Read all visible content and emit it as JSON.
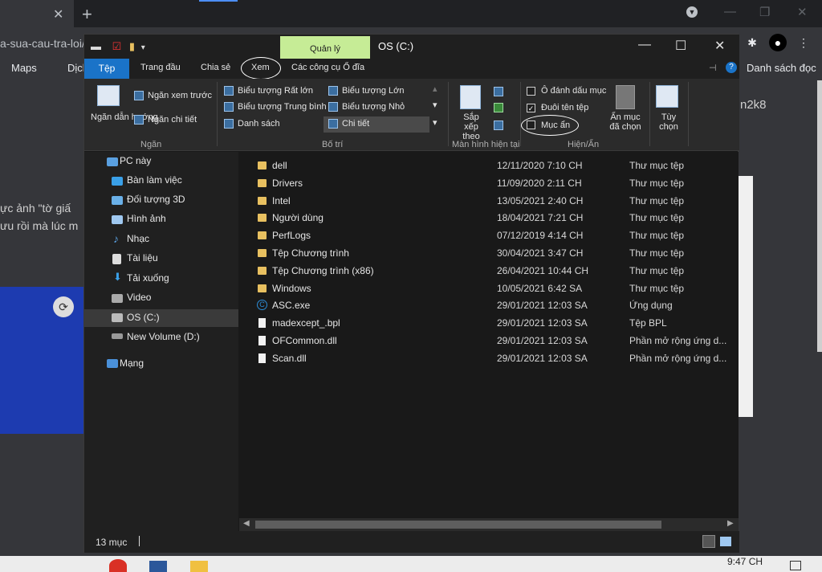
{
  "browser": {
    "url_fragment": "a-sua-cau-tra-loi/",
    "bookmarks": [
      {
        "label": "Maps"
      },
      {
        "label": "Dịch"
      },
      {
        "label": "Danh sách đọc"
      }
    ],
    "page_texts": [
      "ực ảnh \"tờ giấ",
      "ưu rồi mà lúc m",
      "n2k8"
    ]
  },
  "explorer": {
    "title": "OS (C:)",
    "manage_tab": "Quản lý",
    "ribbon_tabs": [
      "Tệp",
      "Trang đầu",
      "Chia sẻ",
      "Xem",
      "Các công cụ Ổ đĩa"
    ],
    "panes": {
      "nav_pane": "Ngăn dẫn hướng",
      "preview_pane": "Ngăn xem trước",
      "details_pane": "Ngăn chi tiết",
      "group": "Ngăn"
    },
    "layout": {
      "items": [
        "Biểu tượng Rất lớn",
        "Biểu tượng Lớn",
        "Biểu tượng Trung bình",
        "Biểu tượng Nhỏ",
        "Danh sách",
        "Chi tiết"
      ],
      "group": "Bố trí"
    },
    "current_view": {
      "sort_by": "Sắp xếp theo",
      "group": "Màn hình hiện tại"
    },
    "show_hide": {
      "item_checkboxes": "Ô đánh dấu mục",
      "item_checkboxes_checked": false,
      "file_extensions": "Đuôi tên tệp",
      "file_extensions_checked": true,
      "hidden_items": "Mục ẩn",
      "hidden_items_checked": false,
      "hide_selected": "Ẩn mục đã chọn",
      "options": "Tùy chọn",
      "group": "Hiện/Ẩn"
    },
    "nav": [
      {
        "label": "PC này"
      },
      {
        "label": "Bàn làm việc"
      },
      {
        "label": "Đối tượng 3D"
      },
      {
        "label": "Hình ảnh"
      },
      {
        "label": "Nhạc"
      },
      {
        "label": "Tài liệu"
      },
      {
        "label": "Tải xuống"
      },
      {
        "label": "Video"
      },
      {
        "label": "OS (C:)"
      },
      {
        "label": "New Volume (D:)"
      },
      {
        "label": "Mạng"
      }
    ],
    "files": [
      {
        "name": "dell",
        "date": "12/11/2020 7:10 CH",
        "type": "Thư mục tệp",
        "kind": "folder"
      },
      {
        "name": "Drivers",
        "date": "11/09/2020 2:11 CH",
        "type": "Thư mục tệp",
        "kind": "folder"
      },
      {
        "name": "Intel",
        "date": "13/05/2021 2:40 CH",
        "type": "Thư mục tệp",
        "kind": "folder"
      },
      {
        "name": "Người dùng",
        "date": "18/04/2021 7:21 CH",
        "type": "Thư mục tệp",
        "kind": "folder"
      },
      {
        "name": "PerfLogs",
        "date": "07/12/2019 4:14 CH",
        "type": "Thư mục tệp",
        "kind": "folder"
      },
      {
        "name": "Tệp Chương trình",
        "date": "30/04/2021 3:47 CH",
        "type": "Thư mục tệp",
        "kind": "folder"
      },
      {
        "name": "Tệp Chương trình (x86)",
        "date": "26/04/2021 10:44 CH",
        "type": "Thư mục tệp",
        "kind": "folder"
      },
      {
        "name": "Windows",
        "date": "10/05/2021 6:42 SA",
        "type": "Thư mục tệp",
        "kind": "folder"
      },
      {
        "name": "ASC.exe",
        "date": "29/01/2021 12:03 SA",
        "type": "Ứng dụng",
        "kind": "exe"
      },
      {
        "name": "madexcept_.bpl",
        "date": "29/01/2021 12:03 SA",
        "type": "Tệp BPL",
        "kind": "file"
      },
      {
        "name": "OFCommon.dll",
        "date": "29/01/2021 12:03 SA",
        "type": "Phần mở rộng ứng d...",
        "kind": "dll"
      },
      {
        "name": "Scan.dll",
        "date": "29/01/2021 12:03 SA",
        "type": "Phần mở rộng ứng d...",
        "kind": "dll"
      }
    ],
    "status": "13 mục"
  },
  "taskbar": {
    "clock": "9:47 CH"
  }
}
